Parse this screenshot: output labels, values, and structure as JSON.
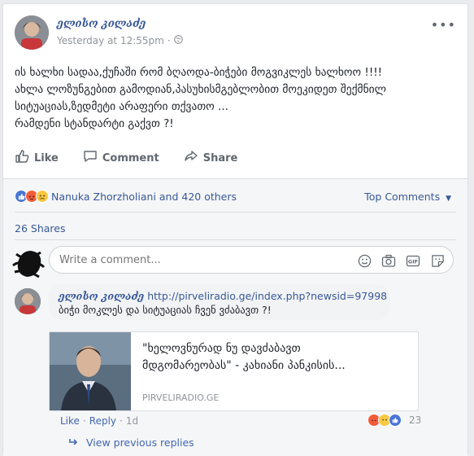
{
  "post": {
    "author": "ელისო კილაძე",
    "time": "Yesterday at 12:55pm",
    "text_lines": [
      "ის ხალხი სადაა,ქუჩაში რომ ბღაოდა-ბიჭები მოგვიკლეს ხალხოო !!!!",
      "ახლა ლოზუნგებით გამოდიან,პასუხისმგებლობით მოეკიდეთ შექმნილ",
      "სიტუაციას,ზედმეტი არაფერი თქვათო ...",
      "რამდენი სტანდარტი გაქვთ ?!"
    ]
  },
  "actions": {
    "like": "Like",
    "comment": "Comment",
    "share": "Share"
  },
  "reactions": {
    "summary": "Nanuka Zhorzholiani and 420 others",
    "top_comments": "Top Comments"
  },
  "shares": "26 Shares",
  "composer": {
    "placeholder": "Write a comment..."
  },
  "comment": {
    "author": "ელისო კილაძე",
    "link": "http://pirveliradio.ge/index.php?newsid=97998",
    "text": "ბიჭი მოკლეს და სიტუაციას ჩვენ ვძაბავთ ?!",
    "link_title_line1": "\"ხელოვნურად ნუ დავძაბავთ",
    "link_title_line2": "მდგომარეობას\" - კახიანი პანკისის...",
    "link_domain": "PIRVELIRADIO.GE",
    "reaction_count": "23",
    "like": "Like",
    "reply": "Reply",
    "time": "1d",
    "view_previous": "View previous replies"
  },
  "colors": {
    "link": "#365899",
    "muted": "#90949c",
    "like_blue": "#4267b2"
  }
}
